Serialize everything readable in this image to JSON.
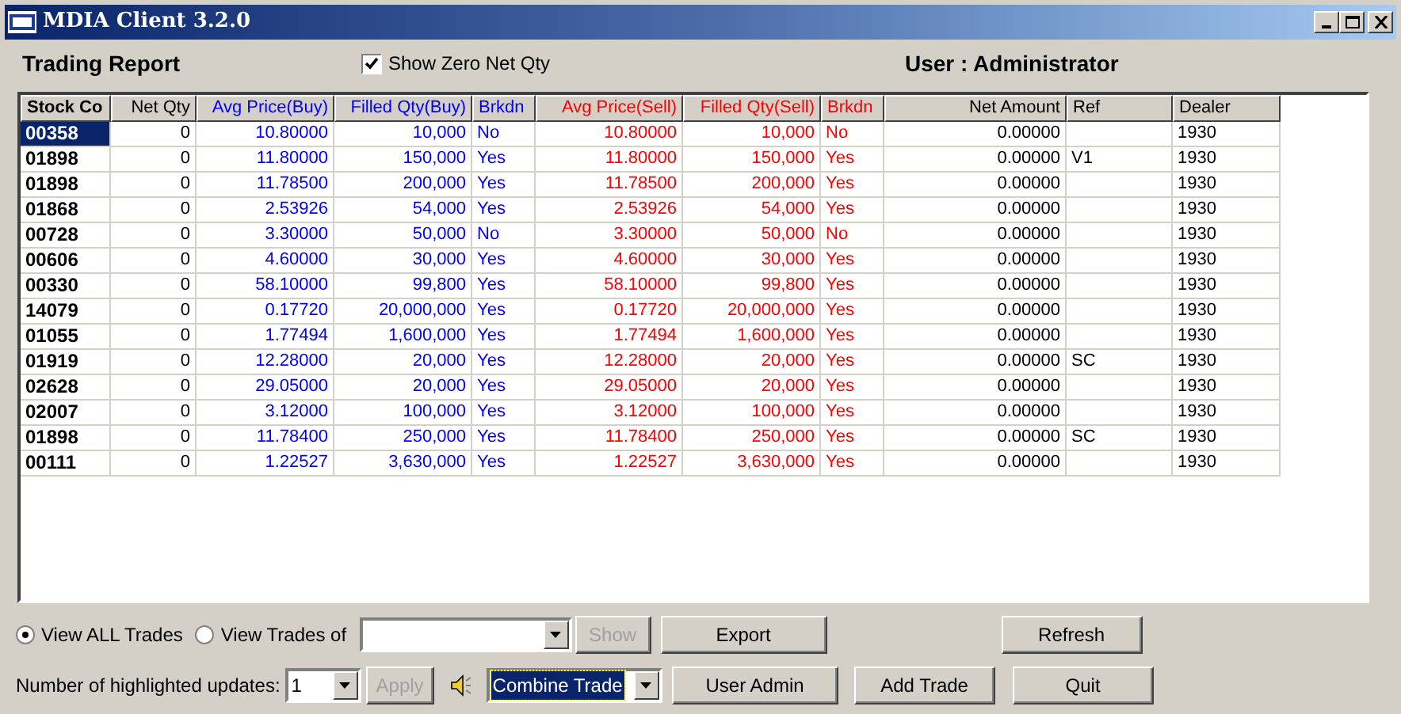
{
  "window": {
    "title": "MDIA Client 3.2.0"
  },
  "header": {
    "title": "Trading Report",
    "show_zero": {
      "label": "Show Zero Net Qty",
      "checked": true
    },
    "user": "User : Administrator"
  },
  "table": {
    "columns": [
      {
        "label": "Stock Co",
        "color": "#000000",
        "kind": "code"
      },
      {
        "label": "Net Qty",
        "color": "#000000",
        "kind": "number"
      },
      {
        "label": "Avg Price(Buy)",
        "color": "#0000ff",
        "kind": "number"
      },
      {
        "label": "Filled Qty(Buy)",
        "color": "#0000ff",
        "kind": "number"
      },
      {
        "label": "Brkdn",
        "color": "#0000ff",
        "kind": "text"
      },
      {
        "label": "Avg Price(Sell)",
        "color": "#ff0000",
        "kind": "number"
      },
      {
        "label": "Filled Qty(Sell)",
        "color": "#ff0000",
        "kind": "number"
      },
      {
        "label": "Brkdn",
        "color": "#ff0000",
        "kind": "text"
      },
      {
        "label": "Net Amount",
        "color": "#000000",
        "kind": "number"
      },
      {
        "label": "Ref",
        "color": "#000000",
        "kind": "text"
      },
      {
        "label": "Dealer",
        "color": "#000000",
        "kind": "text"
      }
    ],
    "rows": [
      {
        "selected": true,
        "cells": [
          "00358",
          "0",
          "10.80000",
          "10,000",
          "No",
          "10.80000",
          "10,000",
          "No",
          "0.00000",
          "",
          "1930"
        ]
      },
      {
        "selected": false,
        "cells": [
          "01898",
          "0",
          "11.80000",
          "150,000",
          "Yes",
          "11.80000",
          "150,000",
          "Yes",
          "0.00000",
          "V1",
          "1930"
        ]
      },
      {
        "selected": false,
        "cells": [
          "01898",
          "0",
          "11.78500",
          "200,000",
          "Yes",
          "11.78500",
          "200,000",
          "Yes",
          "0.00000",
          "",
          "1930"
        ]
      },
      {
        "selected": false,
        "cells": [
          "01868",
          "0",
          "2.53926",
          "54,000",
          "Yes",
          "2.53926",
          "54,000",
          "Yes",
          "0.00000",
          "",
          "1930"
        ]
      },
      {
        "selected": false,
        "cells": [
          "00728",
          "0",
          "3.30000",
          "50,000",
          "No",
          "3.30000",
          "50,000",
          "No",
          "0.00000",
          "",
          "1930"
        ]
      },
      {
        "selected": false,
        "cells": [
          "00606",
          "0",
          "4.60000",
          "30,000",
          "Yes",
          "4.60000",
          "30,000",
          "Yes",
          "0.00000",
          "",
          "1930"
        ]
      },
      {
        "selected": false,
        "cells": [
          "00330",
          "0",
          "58.10000",
          "99,800",
          "Yes",
          "58.10000",
          "99,800",
          "Yes",
          "0.00000",
          "",
          "1930"
        ]
      },
      {
        "selected": false,
        "cells": [
          "14079",
          "0",
          "0.17720",
          "20,000,000",
          "Yes",
          "0.17720",
          "20,000,000",
          "Yes",
          "0.00000",
          "",
          "1930"
        ]
      },
      {
        "selected": false,
        "cells": [
          "01055",
          "0",
          "1.77494",
          "1,600,000",
          "Yes",
          "1.77494",
          "1,600,000",
          "Yes",
          "0.00000",
          "",
          "1930"
        ]
      },
      {
        "selected": false,
        "cells": [
          "01919",
          "0",
          "12.28000",
          "20,000",
          "Yes",
          "12.28000",
          "20,000",
          "Yes",
          "0.00000",
          "SC",
          "1930"
        ]
      },
      {
        "selected": false,
        "cells": [
          "02628",
          "0",
          "29.05000",
          "20,000",
          "Yes",
          "29.05000",
          "20,000",
          "Yes",
          "0.00000",
          "",
          "1930"
        ]
      },
      {
        "selected": false,
        "cells": [
          "02007",
          "0",
          "3.12000",
          "100,000",
          "Yes",
          "3.12000",
          "100,000",
          "Yes",
          "0.00000",
          "",
          "1930"
        ]
      },
      {
        "selected": false,
        "cells": [
          "01898",
          "0",
          "11.78400",
          "250,000",
          "Yes",
          "11.78400",
          "250,000",
          "Yes",
          "0.00000",
          "SC",
          "1930"
        ]
      },
      {
        "selected": false,
        "cells": [
          "00111",
          "0",
          "1.22527",
          "3,630,000",
          "Yes",
          "1.22527",
          "3,630,000",
          "Yes",
          "0.00000",
          "",
          "1930"
        ]
      }
    ]
  },
  "controls": {
    "view_options": [
      {
        "label": "View ALL Trades",
        "selected": true
      },
      {
        "label": "View Trades of",
        "selected": false
      }
    ],
    "show_button": {
      "label": "Show",
      "disabled": true
    },
    "highlight_label": "Number of highlighted updates:",
    "highlight_count": "1",
    "apply_button": {
      "label": "Apply",
      "disabled": true
    },
    "mode_select": {
      "value": "Combine Trade"
    },
    "buttons": [
      {
        "label": "Export"
      },
      {
        "label": "Refresh"
      },
      {
        "label": "User Admin"
      },
      {
        "label": "Add Trade"
      },
      {
        "label": "Quit"
      }
    ]
  }
}
